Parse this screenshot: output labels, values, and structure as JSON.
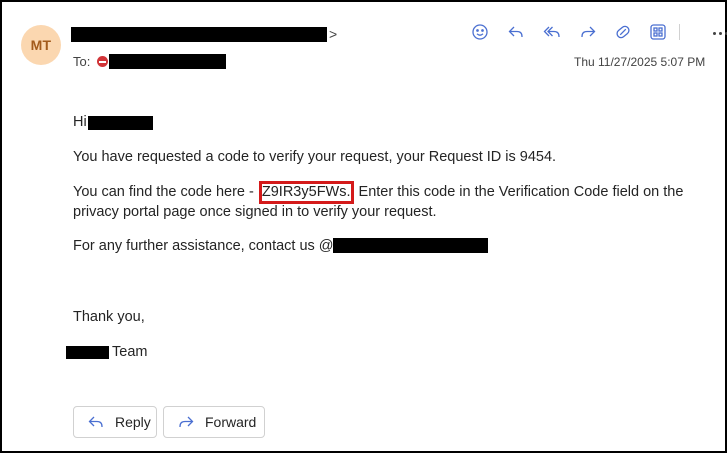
{
  "header": {
    "avatar_initials": "MT",
    "to_label": "To:",
    "date": "Thu 11/27/2025 5:07 PM"
  },
  "toolbar": {
    "icons": [
      "emoji-icon",
      "reply-icon",
      "reply-all-icon",
      "forward-icon",
      "link-icon",
      "apps-icon",
      "more-icon"
    ],
    "accent": "#4a6fd1"
  },
  "body": {
    "greeting": "Hi",
    "line1": "You have requested a code to verify your request, your Request ID is 9454.",
    "line2_prefix": "You can find the code here -",
    "code": "Z9IR3y5FWs.",
    "line2_suffix": "Enter this code in the Verification Code field on the",
    "line3": "privacy portal page once signed in to verify your request.",
    "line4": "For any further assistance, contact us @",
    "thanks": "Thank you,",
    "team": "Team",
    "highlight_color": "#d41a1a"
  },
  "actions": {
    "reply_label": "Reply",
    "forward_label": "Forward"
  }
}
